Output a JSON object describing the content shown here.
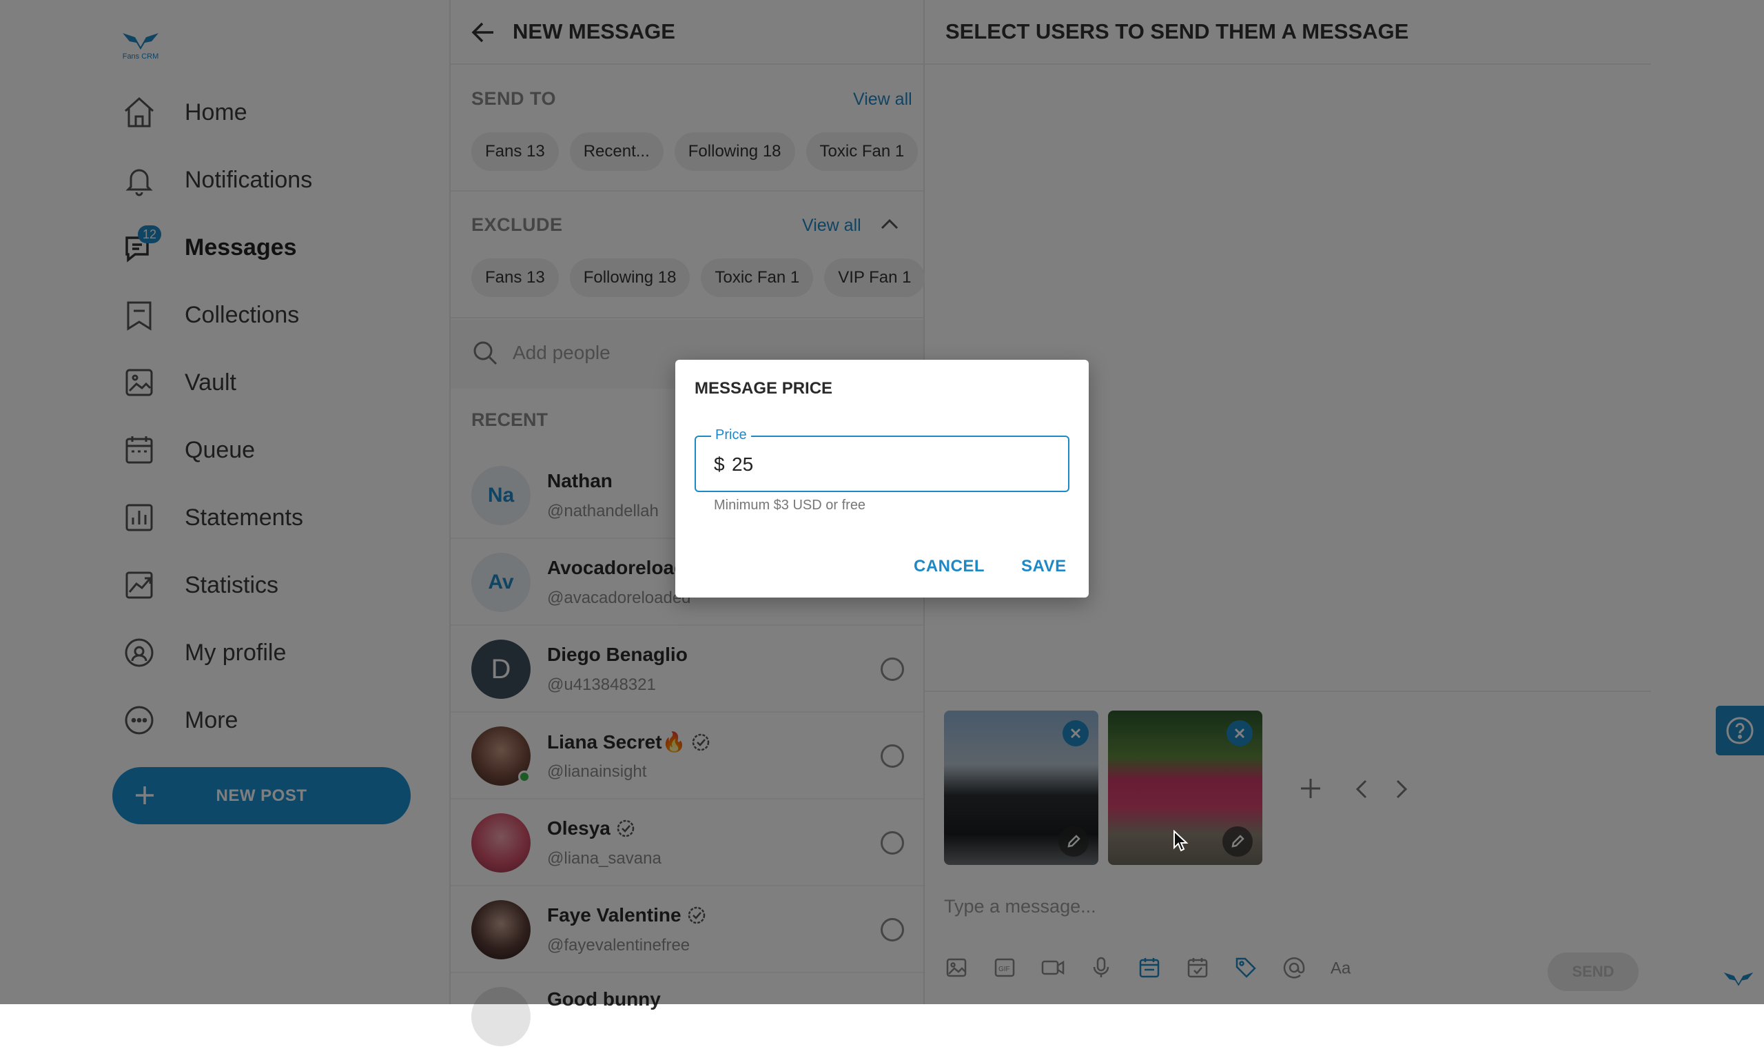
{
  "app": {
    "logo_text": "Fans CRM"
  },
  "sidebar": {
    "items": [
      {
        "label": "Home",
        "icon": "home-icon"
      },
      {
        "label": "Notifications",
        "icon": "bell-icon"
      },
      {
        "label": "Messages",
        "icon": "messages-icon",
        "badge": "12",
        "active": true
      },
      {
        "label": "Collections",
        "icon": "bookmark-icon"
      },
      {
        "label": "Vault",
        "icon": "image-icon"
      },
      {
        "label": "Queue",
        "icon": "calendar-icon"
      },
      {
        "label": "Statements",
        "icon": "bar-chart-icon"
      },
      {
        "label": "Statistics",
        "icon": "line-chart-icon"
      },
      {
        "label": "My profile",
        "icon": "profile-icon"
      },
      {
        "label": "More",
        "icon": "more-icon"
      }
    ],
    "new_post_label": "NEW POST"
  },
  "new_message": {
    "title": "NEW MESSAGE",
    "send_to": {
      "title": "SEND TO",
      "view_all": "View all",
      "chips": [
        "Fans 13",
        "Recent...",
        "Following 18",
        "Toxic Fan 1"
      ]
    },
    "exclude": {
      "title": "EXCLUDE",
      "view_all": "View all",
      "chips": [
        "Fans 13",
        "Following 18",
        "Toxic Fan 1",
        "VIP Fan 1"
      ]
    },
    "search_placeholder": "Add people",
    "recent_title": "RECENT",
    "users": [
      {
        "name": "Nathan",
        "handle": "@nathandellah",
        "initials": "Na"
      },
      {
        "name": "Avocadoreloaded",
        "handle": "@avacadoreloaded",
        "initials": "Av"
      },
      {
        "name": "Diego Benaglio",
        "handle": "@u413848321",
        "initials": "D"
      },
      {
        "name": "Liana Secret🔥",
        "handle": "@lianainsight",
        "verified": true,
        "online": true
      },
      {
        "name": "Olesya",
        "handle": "@liana_savana",
        "verified": true
      },
      {
        "name": "Faye Valentine",
        "handle": "@fayevalentinefree",
        "verified": true
      },
      {
        "name": "Good bunny",
        "handle": ""
      }
    ]
  },
  "right_panel": {
    "title": "SELECT USERS TO SEND THEM A MESSAGE",
    "message_placeholder": "Type a message...",
    "send_label": "SEND",
    "toolbar_icons": [
      "image-icon",
      "gif-icon",
      "video-icon",
      "mic-icon",
      "vault-icon",
      "schedule-icon",
      "price-tag-icon",
      "mention-icon",
      "text-format-icon"
    ]
  },
  "dialog": {
    "title": "MESSAGE PRICE",
    "field_label": "Price",
    "currency": "$",
    "value": "25",
    "helper": "Minimum $3 USD or free",
    "cancel_label": "CANCEL",
    "save_label": "SAVE"
  },
  "colors": {
    "accent": "#1e88c7",
    "overlay": "rgba(0,0,0,0.5)"
  }
}
